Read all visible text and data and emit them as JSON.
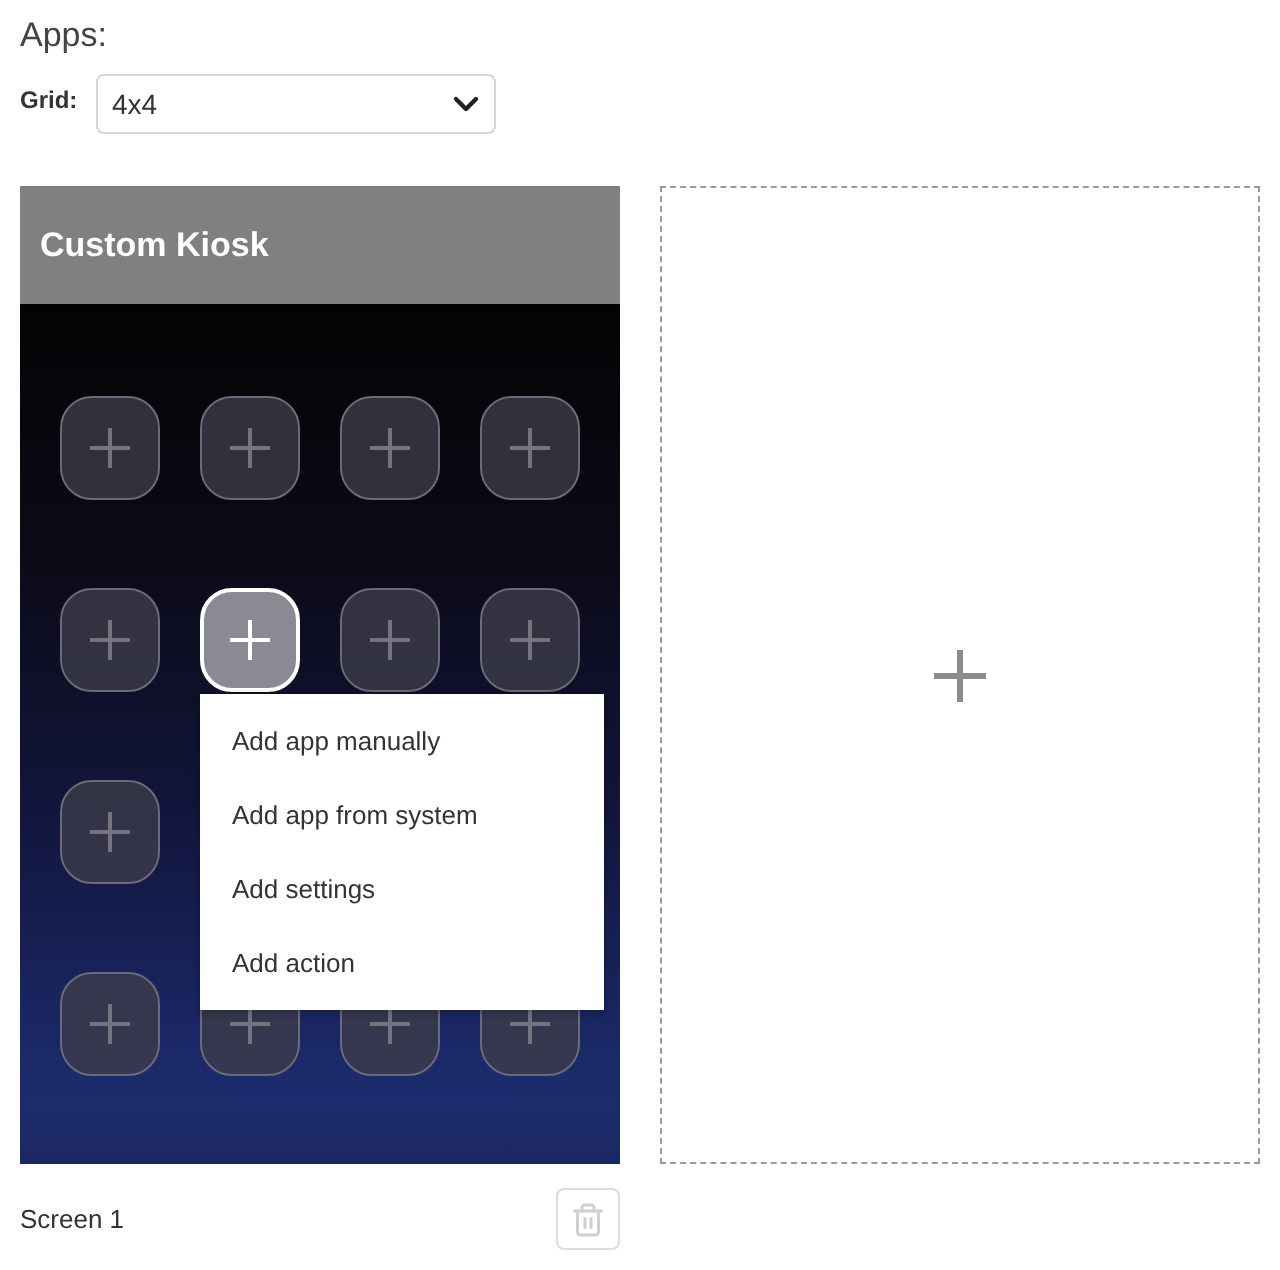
{
  "section_title": "Apps:",
  "grid_select": {
    "label": "Grid:",
    "value": "4x4"
  },
  "screens": [
    {
      "title": "Custom Kiosk",
      "label": "Screen 1",
      "tile_rows": [
        {
          "tiles": [
            {
              "selected": false
            },
            {
              "selected": false
            },
            {
              "selected": false
            },
            {
              "selected": false
            }
          ]
        },
        {
          "tiles": [
            {
              "selected": false
            },
            {
              "selected": true
            },
            {
              "selected": false
            },
            {
              "selected": false
            }
          ]
        },
        {
          "tiles": [
            {
              "selected": false
            }
          ]
        },
        {
          "tiles": [
            {
              "selected": false
            },
            {
              "selected": false
            },
            {
              "selected": false
            },
            {
              "selected": false
            }
          ]
        }
      ]
    }
  ],
  "context_menu": {
    "items": [
      "Add app manually",
      "Add app from system",
      "Add settings",
      "Add action"
    ]
  }
}
